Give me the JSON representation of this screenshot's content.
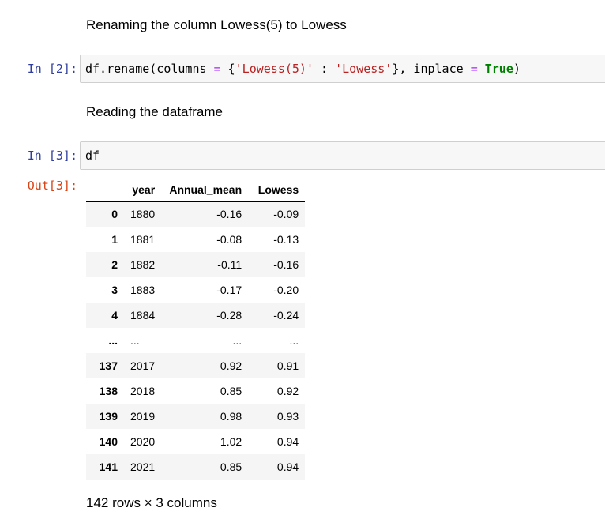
{
  "markdown": {
    "rename_note": "Renaming the column Lowess(5) to Lowess",
    "read_note": "Reading the dataframe"
  },
  "cells": [
    {
      "prompt": "In [2]:",
      "code": {
        "t1": "df.rename(columns ",
        "t2": "=",
        "t3": " {",
        "t4": "'Lowess(5)'",
        "t5": " : ",
        "t6": "'Lowess'",
        "t7": "}, inplace ",
        "t8": "=",
        "t9": " ",
        "t10": "True",
        "t11": ")"
      }
    },
    {
      "prompt": "In [3]:",
      "code": "df",
      "out_prompt": "Out[3]:"
    }
  ],
  "dataframe": {
    "columns": [
      "",
      "year",
      "Annual_mean",
      "Lowess"
    ],
    "rows": [
      [
        "0",
        "1880",
        "-0.16",
        "-0.09"
      ],
      [
        "1",
        "1881",
        "-0.08",
        "-0.13"
      ],
      [
        "2",
        "1882",
        "-0.11",
        "-0.16"
      ],
      [
        "3",
        "1883",
        "-0.17",
        "-0.20"
      ],
      [
        "4",
        "1884",
        "-0.28",
        "-0.24"
      ],
      [
        "...",
        "...",
        "...",
        "..."
      ],
      [
        "137",
        "2017",
        "0.92",
        "0.91"
      ],
      [
        "138",
        "2018",
        "0.85",
        "0.92"
      ],
      [
        "139",
        "2019",
        "0.98",
        "0.93"
      ],
      [
        "140",
        "2020",
        "1.02",
        "0.94"
      ],
      [
        "141",
        "2021",
        "0.85",
        "0.94"
      ]
    ],
    "summary": "142 rows × 3 columns"
  }
}
